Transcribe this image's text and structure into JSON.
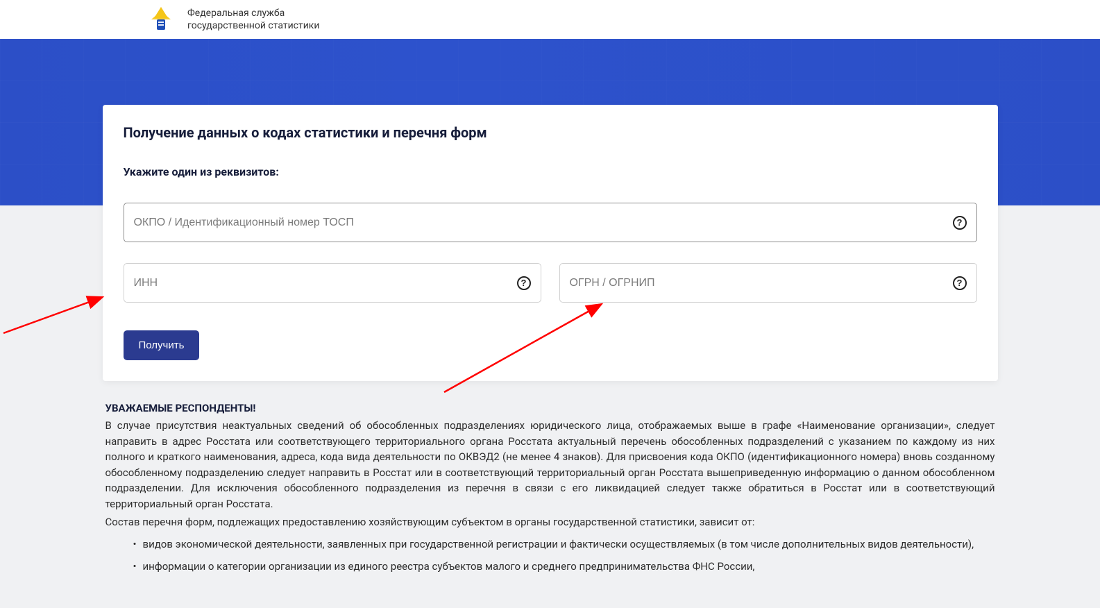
{
  "header": {
    "title_line1": "Федеральная служба",
    "title_line2": "государственной статистики"
  },
  "card": {
    "title": "Получение данных о кодах статистики и перечня форм",
    "subtitle": "Укажите один из реквизитов:",
    "okpo_placeholder": "ОКПО / Идентификационный номер ТОСП",
    "inn_placeholder": "ИНН",
    "ogrn_placeholder": "ОГРН / ОГРНИП",
    "submit_label": "Получить",
    "help_glyph": "?"
  },
  "info": {
    "heading": "УВАЖАЕМЫЕ РЕСПОНДЕНТЫ!",
    "paragraph": "В случае присутствия неактуальных сведений об обособленных подразделениях юридического лица, отображаемых выше в графе «Наименование организации», следует направить в адрес Росстата или соответствующего территориального органа Росстата актуальный перечень обособленных подразделений с указанием по каждому из них полного и краткого наименования, адреса, кода вида деятельности по ОКВЭД2 (не менее 4 знаков). Для присвоения кода ОКПО (идентификационного номера) вновь созданному обособленному подразделению следует направить в Росстат или в соответствующий территориальный орган Росстата вышеприведенную информацию о данном обособленном подразделении. Для исключения обособленного подразделения из перечня в связи с его ликвидацией следует также обратиться в Росстат или в соответствующий территориальный орган Росстата.",
    "list_intro": "Состав перечня форм, подлежащих предоставлению хозяйствующим субъектом в органы государственной статистики, зависит от:",
    "list_items": [
      "видов экономической деятельности, заявленных при государственной регистрации и фактически осуществляемых (в том числе дополнительных видов деятельности),",
      "информации о категории организации из единого реестра субъектов малого и среднего предпринимательства ФНС России,"
    ]
  },
  "colors": {
    "primary": "#2b3b90",
    "banner": "#2c4fc7",
    "arrow": "#ff0000"
  }
}
